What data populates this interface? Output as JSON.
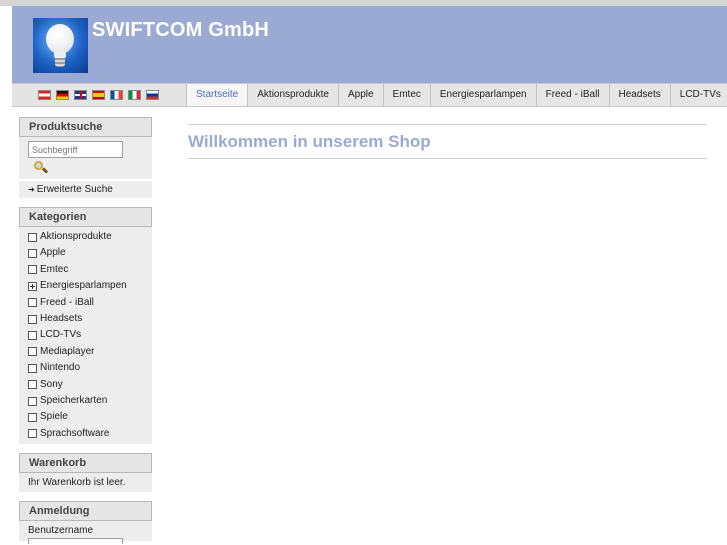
{
  "header": {
    "brand": "SWIFTCOM GmbH"
  },
  "languages": [
    {
      "code": "at",
      "icon": "austria-flag-icon"
    },
    {
      "code": "de",
      "icon": "germany-flag-icon"
    },
    {
      "code": "gb",
      "icon": "uk-flag-icon"
    },
    {
      "code": "es",
      "icon": "spain-flag-icon"
    },
    {
      "code": "fr",
      "icon": "france-flag-icon"
    },
    {
      "code": "it",
      "icon": "italy-flag-icon"
    },
    {
      "code": "ru",
      "icon": "russia-flag-icon"
    }
  ],
  "nav": {
    "tabs": [
      {
        "label": "Startseite",
        "active": true
      },
      {
        "label": "Aktionsprodukte",
        "active": false
      },
      {
        "label": "Apple",
        "active": false
      },
      {
        "label": "Emtec",
        "active": false
      },
      {
        "label": "Energiesparlampen",
        "active": false
      },
      {
        "label": "Freed - iBall",
        "active": false
      },
      {
        "label": "Headsets",
        "active": false
      },
      {
        "label": "LCD-TVs",
        "active": false
      }
    ]
  },
  "sidebar": {
    "search": {
      "title": "Produktsuche",
      "placeholder": "Suchbegriff",
      "advanced_link": "Erweiterte Suche"
    },
    "categories": {
      "title": "Kategorien",
      "items": [
        {
          "label": "Aktionsprodukte",
          "expandable": false
        },
        {
          "label": "Apple",
          "expandable": false
        },
        {
          "label": "Emtec",
          "expandable": false
        },
        {
          "label": "Energiesparlampen",
          "expandable": true
        },
        {
          "label": "Freed - iBall",
          "expandable": false
        },
        {
          "label": "Headsets",
          "expandable": false
        },
        {
          "label": "LCD-TVs",
          "expandable": false
        },
        {
          "label": "Mediaplayer",
          "expandable": false
        },
        {
          "label": "Nintendo",
          "expandable": false
        },
        {
          "label": "Sony",
          "expandable": false
        },
        {
          "label": "Speicherkarten",
          "expandable": false
        },
        {
          "label": "Spiele",
          "expandable": false
        },
        {
          "label": "Sprachsoftware",
          "expandable": false
        }
      ]
    },
    "cart": {
      "title": "Warenkorb",
      "text": "Ihr Warenkorb ist leer."
    },
    "login": {
      "title": "Anmeldung",
      "username_label": "Benutzername"
    }
  },
  "main": {
    "welcome": "Willkommen in unserem Shop"
  },
  "colors": {
    "header_bg": "#9aaad2",
    "active_tab": "#4a6fb2",
    "welcome_text": "#9aaad2"
  }
}
